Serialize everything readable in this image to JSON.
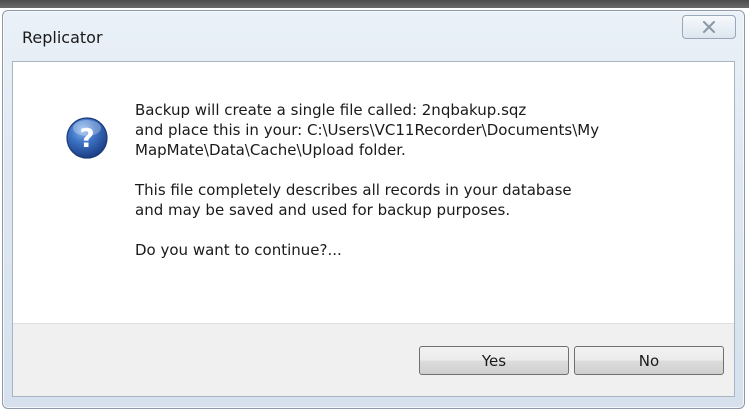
{
  "dialog": {
    "title": "Replicator",
    "close_icon": "close-icon",
    "icon": "question-icon",
    "message": {
      "line1": "Backup will create a single file called: 2nqbakup.sqz",
      "line2": "and place this in your: C:\\Users\\VC11Recorder\\Documents\\My",
      "line3": "MapMate\\Data\\Cache\\Upload folder.",
      "line4": "This file completely describes all records in your database",
      "line5": "and may be saved and used for backup purposes.",
      "line6": "Do you want to continue?..."
    },
    "buttons": {
      "yes_label": "Yes",
      "no_label": "No"
    }
  }
}
